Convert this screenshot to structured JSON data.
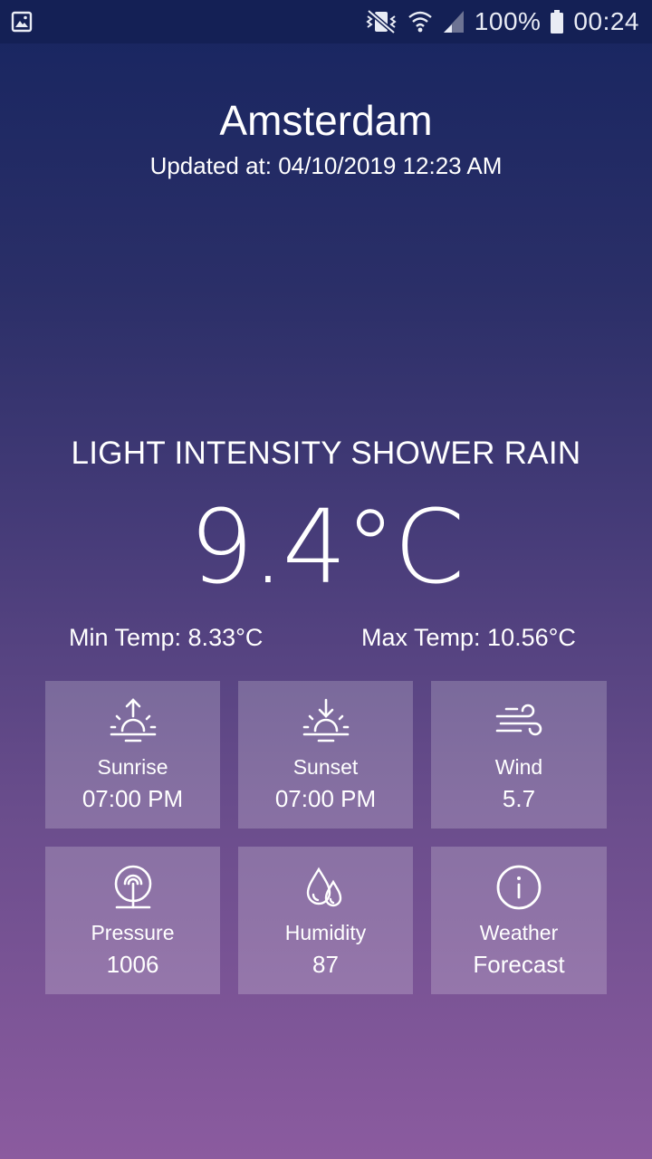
{
  "status_bar": {
    "battery": "100%",
    "time": "00:24"
  },
  "header": {
    "city": "Amsterdam",
    "updated": "Updated at: 04/10/2019 12:23 AM"
  },
  "current": {
    "condition": "LIGHT INTENSITY SHOWER RAIN",
    "temperature": "9.4°C",
    "min_temp": "Min Temp: 8.33°C",
    "max_temp": "Max Temp: 10.56°C"
  },
  "tiles": [
    {
      "label": "Sunrise",
      "value": "07:00 PM",
      "icon": "sunrise-icon"
    },
    {
      "label": "Sunset",
      "value": "07:00 PM",
      "icon": "sunset-icon"
    },
    {
      "label": "Wind",
      "value": "5.7",
      "icon": "wind-icon"
    },
    {
      "label": "Pressure",
      "value": "1006",
      "icon": "pressure-icon"
    },
    {
      "label": "Humidity",
      "value": "87",
      "icon": "humidity-icon"
    },
    {
      "label": "Weather",
      "value": "Forecast",
      "icon": "info-icon"
    }
  ]
}
